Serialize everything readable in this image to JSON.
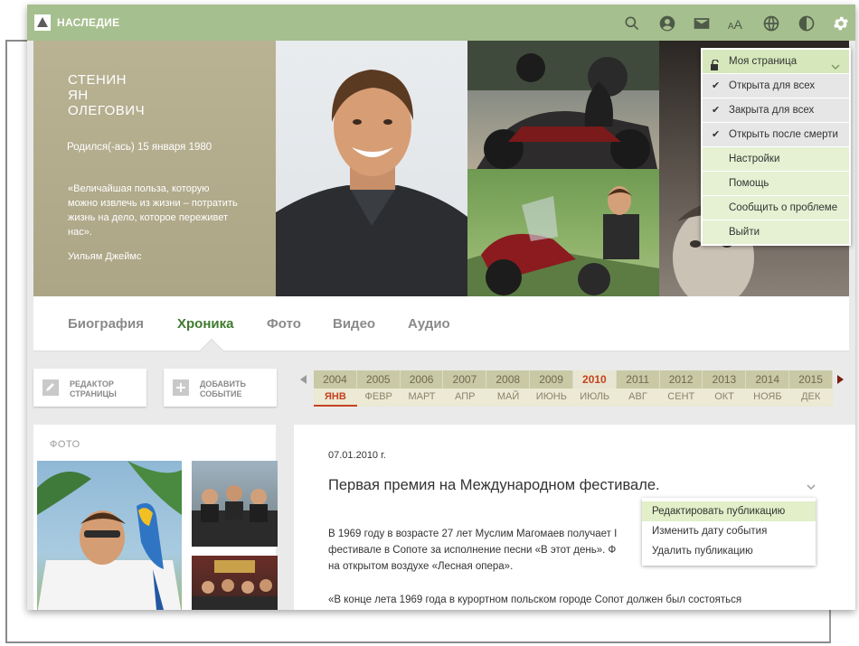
{
  "app": {
    "brand": "НАСЛЕДИЕ"
  },
  "person": {
    "name_line1": "СТЕНИН",
    "name_line2": "ЯН",
    "name_line3": "ОЛЕГОВИЧ",
    "born": "Родился(-ась) 15 января 1980",
    "quote": "«Величайшая польза, которую можно извлечь из жизни – потратить жизнь на дело, которое переживет нас».",
    "quote_author": "Уильям Джеймс"
  },
  "tabs": [
    "Биография",
    "Хроника",
    "Фото",
    "Видео",
    "Аудио"
  ],
  "active_tab": "Хроника",
  "actions": {
    "edit_page_line1": "РЕДАКТОР",
    "edit_page_line2": "СТРАНИЦЫ",
    "add_event_line1": "ДОБАВИТЬ",
    "add_event_line2": "СОБЫТИЕ"
  },
  "timeline": {
    "years": [
      "2004",
      "2005",
      "2006",
      "2007",
      "2008",
      "2009",
      "2010",
      "2011",
      "2012",
      "2013",
      "2014",
      "2015"
    ],
    "active_year": "2010",
    "months": [
      "ЯНВ",
      "ФЕВР",
      "МАРТ",
      "АПР",
      "МАЙ",
      "ИЮНЬ",
      "ИЮЛЬ",
      "АВГ",
      "СЕНТ",
      "ОКТ",
      "НОЯБ",
      "ДЕК"
    ],
    "active_month": "ЯНВ"
  },
  "photos_panel": {
    "title": "ФОТО"
  },
  "post": {
    "date": "07.01.2010 г.",
    "title": "Первая премия на Международном фестивале.",
    "paragraph1_line1": "В 1969 году в возрасте 27 лет Муслим Магомаев получает I",
    "paragraph1_line2": "фестивале в Сопоте за исполнение песни «В этот день». Ф",
    "paragraph1_line3": "на открытом воздухе «Лесная опера».",
    "paragraph2": "«В конце лета 1969 года в курортном польском городе Сопот должен был состояться"
  },
  "post_menu": [
    "Редактировать публикацию",
    "Изменить дату события",
    "Удалить публикацию"
  ],
  "settings_menu": {
    "header": "Моя страница",
    "items": [
      "Открыта для всех",
      "Закрыта для всех",
      "Открыть после смерти",
      "Настройки",
      "Помощь",
      "Сообщить о проблеме",
      "Выйти"
    ]
  },
  "colors": {
    "topbar": "#a6bf8e",
    "accent_green": "#3f7a2e",
    "timeline_active": "#c4421f",
    "hero_info": "#b3ac8d"
  },
  "icons": [
    "search-icon",
    "user-icon",
    "mail-icon",
    "font-size-icon",
    "globe-icon",
    "contrast-icon",
    "gear-icon"
  ]
}
